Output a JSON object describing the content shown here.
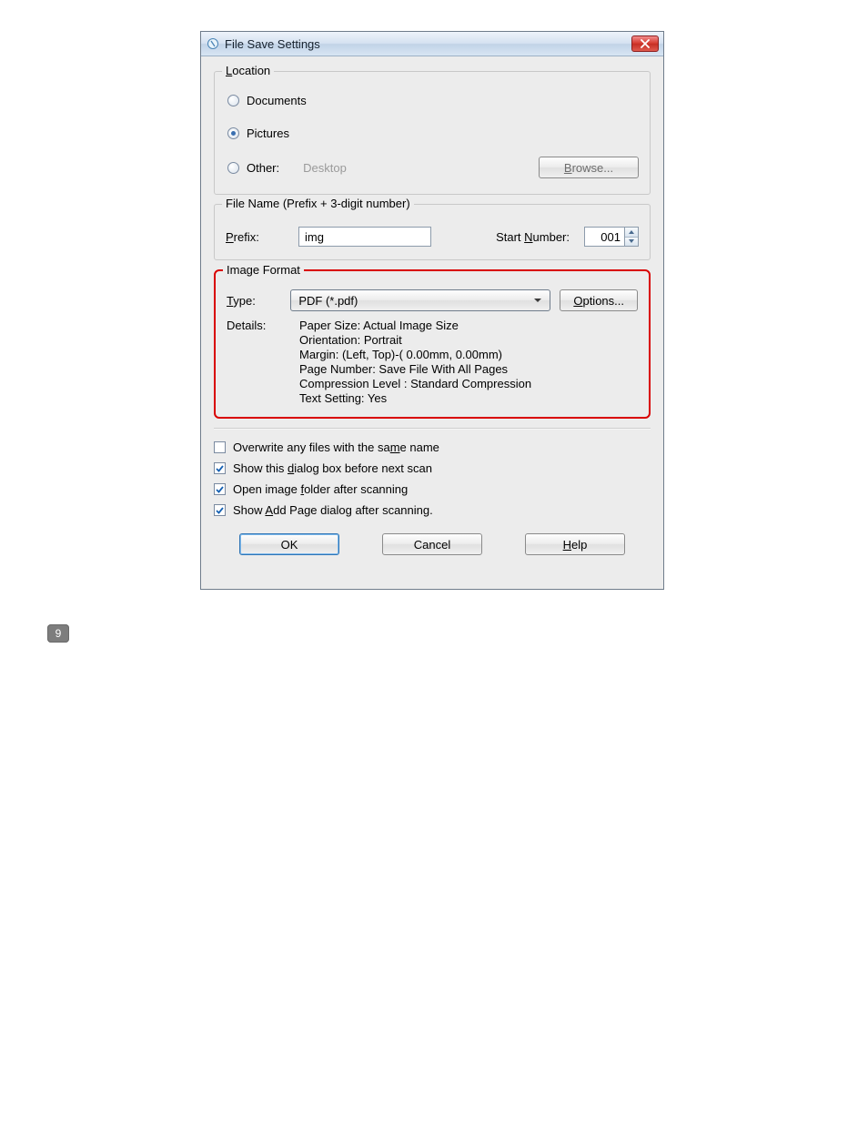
{
  "step_badge": "9",
  "dialog": {
    "title": "File Save Settings",
    "close_icon": "close",
    "location": {
      "legend_pre": "L",
      "legend_post": "ocation",
      "documents_label": "Documents",
      "pictures_label": "Pictures",
      "other_label": "Other:",
      "other_path": "Desktop",
      "browse_pre": "B",
      "browse_post": "rowse...",
      "selected": "pictures"
    },
    "filename": {
      "legend": "File Name (Prefix + 3-digit number)",
      "prefix_label_pre": "P",
      "prefix_label_post": "refix:",
      "prefix_value": "img",
      "start_label_pre": "Start ",
      "start_label_mn": "N",
      "start_label_post": "umber:",
      "start_value": "001"
    },
    "format": {
      "legend": "Image Format",
      "type_label_pre": "T",
      "type_label_post": "ype:",
      "type_value": "PDF (*.pdf)",
      "options_pre": "O",
      "options_post": "ptions...",
      "details_label": "Details:",
      "details_lines": {
        "l1": "Paper Size: Actual Image Size",
        "l2": "Orientation: Portrait",
        "l3": "Margin: (Left, Top)-( 0.00mm, 0.00mm)",
        "l4": "Page Number: Save File With All Pages",
        "l5": "Compression Level : Standard Compression",
        "l6": "Text Setting: Yes"
      }
    },
    "checks": {
      "overwrite_pre": "Overwrite any files with the sa",
      "overwrite_mn": "m",
      "overwrite_post": "e name",
      "overwrite_checked": false,
      "showdlg_pre": "Show this ",
      "showdlg_mn": "d",
      "showdlg_post": "ialog box before next scan",
      "showdlg_checked": true,
      "openfolder_pre": "Open image ",
      "openfolder_mn": "f",
      "openfolder_post": "older after scanning",
      "openfolder_checked": true,
      "addpage_pre": "Show ",
      "addpage_mn": "A",
      "addpage_post": "dd Page dialog after scanning.",
      "addpage_checked": true
    },
    "buttons": {
      "ok": "OK",
      "cancel": "Cancel",
      "help_pre": "H",
      "help_post": "elp"
    }
  }
}
